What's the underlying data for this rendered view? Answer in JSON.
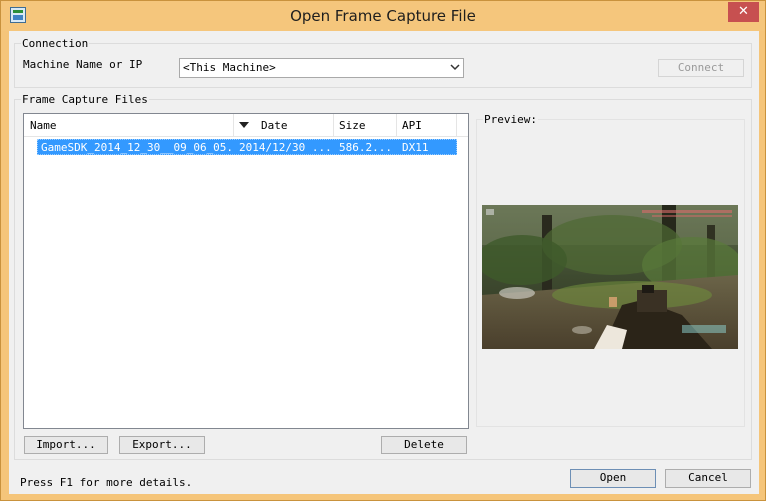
{
  "window": {
    "title": "Open Frame Capture File",
    "close_glyph": "✕"
  },
  "connection": {
    "group_label": "Connection",
    "machine_label": "Machine Name or IP",
    "machine_value": "<This Machine>",
    "connect_label": "Connect"
  },
  "files": {
    "group_label": "Frame Capture Files",
    "columns": {
      "name": "Name",
      "date": "Date",
      "size": "Size",
      "api": "API"
    },
    "sort_indicator": "date-descending",
    "rows": [
      {
        "name": "GameSDK_2014_12_30__09_06_05...",
        "date": "2014/12/30 ...",
        "size": "586.2...",
        "api": "DX11",
        "selected": true
      }
    ],
    "import_label": "Import...",
    "export_label": "Export...",
    "delete_label": "Delete"
  },
  "preview": {
    "label": "Preview:"
  },
  "footer": {
    "hint": "Press F1 for more details.",
    "open_label": "Open",
    "cancel_label": "Cancel"
  },
  "colors": {
    "title_bar": "#f5c67c",
    "close_button": "#c75050",
    "selection": "#3399ff"
  }
}
